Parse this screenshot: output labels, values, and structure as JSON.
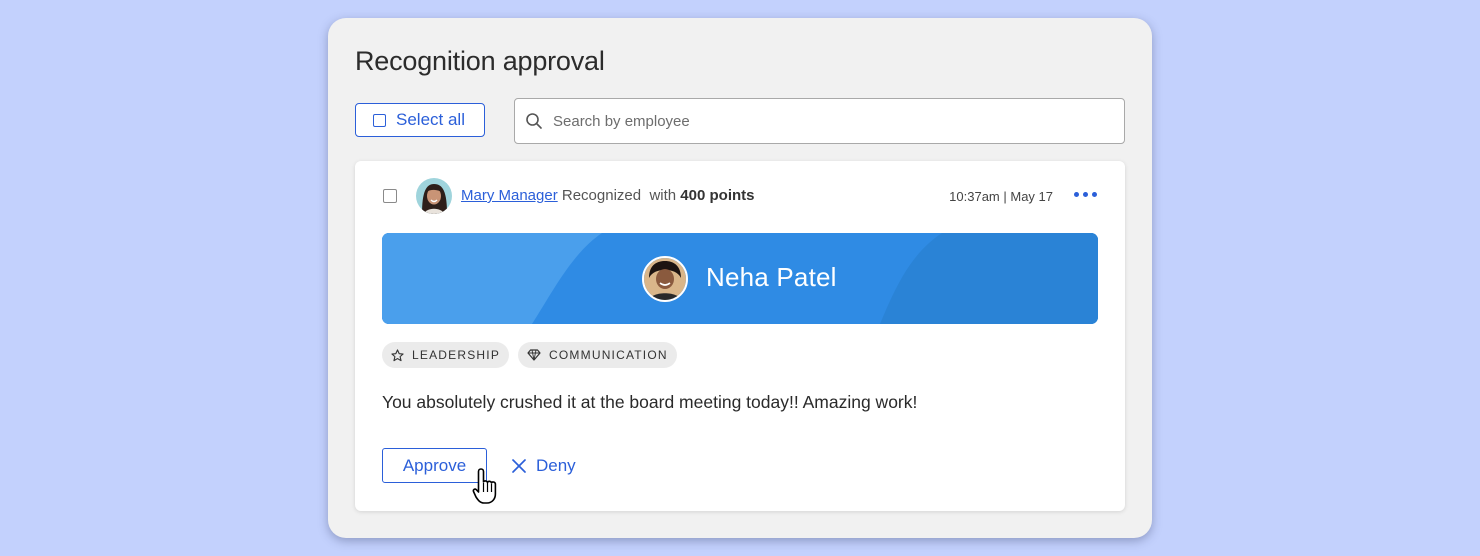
{
  "panel": {
    "title": "Recognition approval"
  },
  "toolbar": {
    "select_all_label": "Select all",
    "search_placeholder": "Search by employee"
  },
  "recognition": {
    "giver_name": "Mary Manager",
    "action_text": "Recognized",
    "with_text": "with",
    "points_text": "400 points",
    "timestamp": "10:37am | May 17",
    "recipient_name": "Neha Patel",
    "tags": [
      {
        "label": "LEADERSHIP",
        "icon": "star-icon"
      },
      {
        "label": "COMMUNICATION",
        "icon": "diamond-icon"
      }
    ],
    "message": "You absolutely crushed it at the board meeting today!! Amazing work!",
    "approve_label": "Approve",
    "deny_label": "Deny"
  },
  "colors": {
    "background": "#c3d1fd",
    "accent": "#2b5fd9",
    "banner": "#3391e6"
  }
}
